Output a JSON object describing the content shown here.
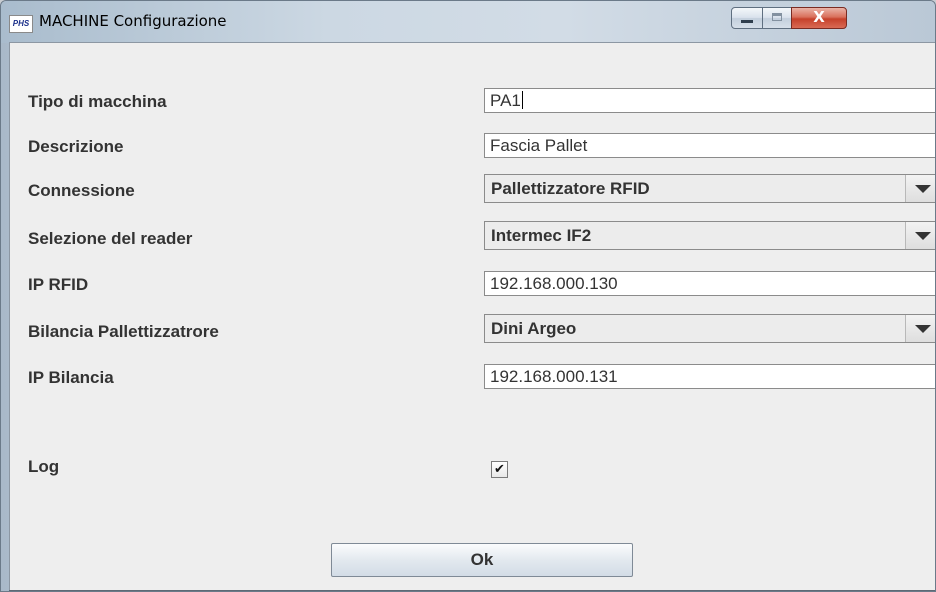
{
  "window": {
    "title": "MACHINE Configurazione",
    "logo_text": "PHS",
    "close_glyph": "X"
  },
  "form": {
    "machine_type": {
      "label": "Tipo di macchina",
      "value": "PA1"
    },
    "description": {
      "label": "Descrizione",
      "value": "Fascia Pallet"
    },
    "connection": {
      "label": "Connessione",
      "selected": "Pallettizzatore  RFID"
    },
    "reader": {
      "label": "Selezione del reader",
      "selected": "Intermec  IF2"
    },
    "ip_rfid": {
      "label": "IP RFID",
      "value": "192.168.000.130"
    },
    "scale": {
      "label": "Bilancia Pallettizzatrore",
      "selected": "Dini Argeo"
    },
    "ip_scale": {
      "label": "IP Bilancia",
      "value": "192.168.000.131"
    },
    "log": {
      "label": "Log",
      "checked": true,
      "check_glyph": "✔"
    }
  },
  "actions": {
    "ok_label": "Ok"
  },
  "icons": [
    "phs-logo-icon",
    "minimize-icon",
    "maximize-icon",
    "close-icon",
    "dropdown-arrow-icon",
    "checkmark-icon"
  ]
}
